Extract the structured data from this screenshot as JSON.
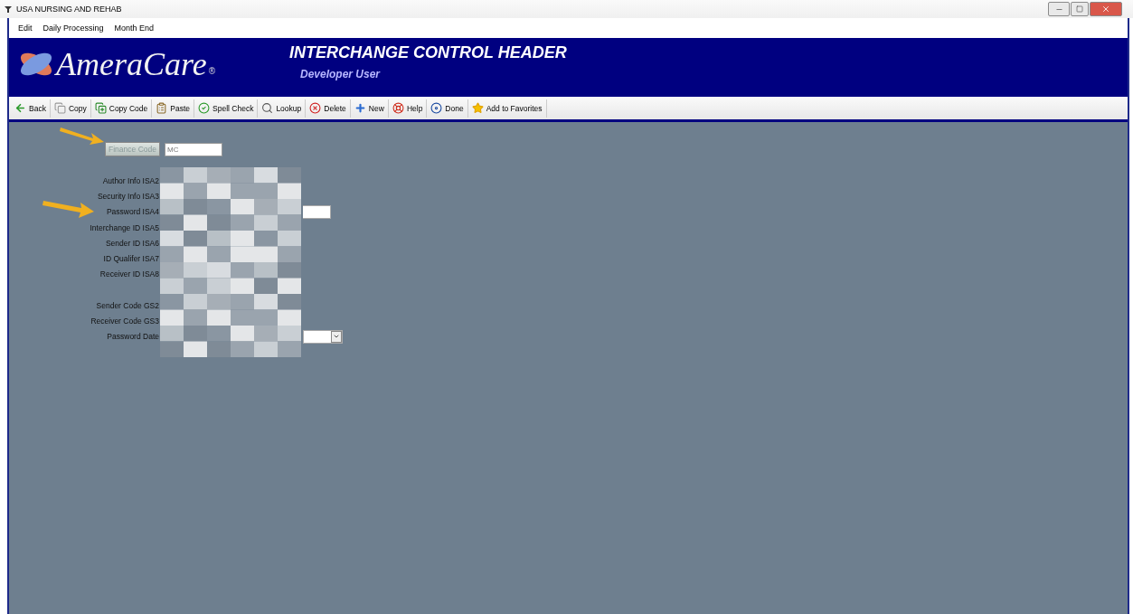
{
  "window": {
    "title": "USA NURSING AND REHAB"
  },
  "menu": [
    "Edit",
    "Daily Processing",
    "Month End"
  ],
  "header": {
    "logo": "AmeraCare",
    "logo_mark": "®",
    "title": "INTERCHANGE CONTROL HEADER",
    "user": "Developer User"
  },
  "toolbar": [
    "Back",
    "Copy",
    "Copy Code",
    "Paste",
    "Spell Check",
    "Lookup",
    "Delete",
    "New",
    "Help",
    "Done",
    "Add to Favorites"
  ],
  "finance_code": {
    "button": "Finance Code",
    "value": "MC"
  },
  "field_groups": [
    [
      {
        "label": "Author Info ISA2",
        "kind": "covered"
      },
      {
        "label": "Security Info ISA3",
        "kind": "covered"
      },
      {
        "label": "Password ISA4",
        "kind": "wide"
      },
      {
        "label": "Interchange ID ISA5",
        "kind": "covered"
      },
      {
        "label": "Sender ID ISA6",
        "kind": "covered"
      },
      {
        "label": "ID Qualifer ISA7",
        "kind": "covered"
      },
      {
        "label": "Receiver ID ISA8",
        "kind": "covered"
      }
    ],
    [
      {
        "label": "Sender Code GS2",
        "kind": "covered"
      },
      {
        "label": "Receiver Code GS3",
        "kind": "covered"
      },
      {
        "label": "Password Date",
        "kind": "date"
      }
    ]
  ]
}
